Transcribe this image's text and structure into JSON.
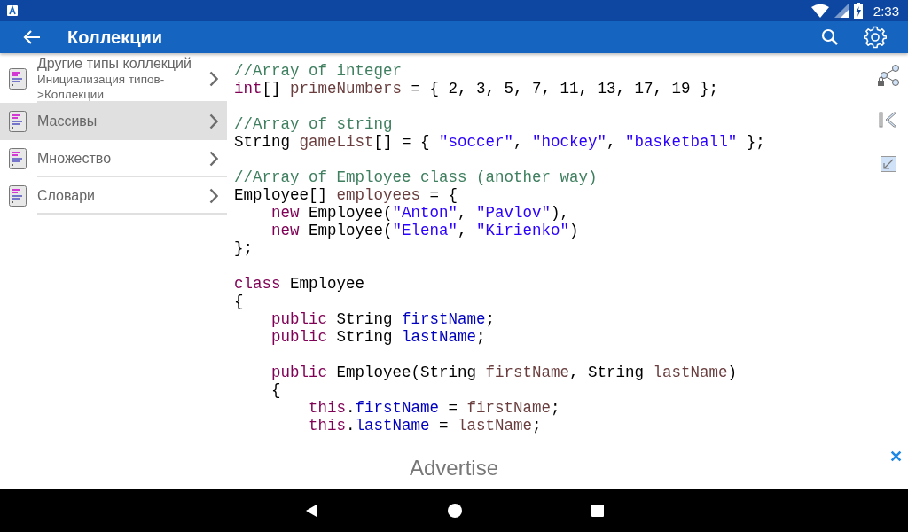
{
  "status_bar": {
    "time": "2:33"
  },
  "app_bar": {
    "title": "Коллекции"
  },
  "sidebar": {
    "items": [
      {
        "title": "Другие типы коллекций",
        "subtitle": "Инициализация типов->Коллекции",
        "selected": false
      },
      {
        "title": "Массивы",
        "selected": true
      },
      {
        "title": "Множество",
        "selected": false
      },
      {
        "title": "Словари",
        "selected": false
      }
    ]
  },
  "code_blocks": [
    {
      "lines": [
        {
          "tokens": [
            {
              "kind": "comment",
              "text": "//Array of integer"
            }
          ]
        },
        {
          "tokens": [
            {
              "kind": "keyword",
              "text": "int"
            },
            {
              "kind": "plain",
              "text": "[] "
            },
            {
              "kind": "variable",
              "text": "primeNumbers"
            },
            {
              "kind": "plain",
              "text": " = { 2, 3, 5, 7, 11, 13, 17, 19 };"
            }
          ]
        }
      ]
    },
    {
      "lines": [
        {
          "tokens": [
            {
              "kind": "comment",
              "text": "//Array of string"
            }
          ]
        },
        {
          "tokens": [
            {
              "kind": "plain",
              "text": "String "
            },
            {
              "kind": "variable",
              "text": "gameList"
            },
            {
              "kind": "plain",
              "text": "[] = { "
            },
            {
              "kind": "string",
              "text": "\"soccer\""
            },
            {
              "kind": "plain",
              "text": ", "
            },
            {
              "kind": "string",
              "text": "\"hockey\""
            },
            {
              "kind": "plain",
              "text": ", "
            },
            {
              "kind": "string",
              "text": "\"basketball\""
            },
            {
              "kind": "plain",
              "text": " };"
            }
          ]
        }
      ]
    },
    {
      "lines": [
        {
          "tokens": [
            {
              "kind": "comment",
              "text": "//Array of Employee class (another way)"
            }
          ]
        },
        {
          "tokens": [
            {
              "kind": "plain",
              "text": "Employee[] "
            },
            {
              "kind": "variable",
              "text": "employees"
            },
            {
              "kind": "plain",
              "text": " = {"
            }
          ]
        },
        {
          "tokens": [
            {
              "kind": "keyword",
              "text": "    new"
            },
            {
              "kind": "plain",
              "text": " Employee("
            },
            {
              "kind": "string",
              "text": "\"Anton\""
            },
            {
              "kind": "plain",
              "text": ", "
            },
            {
              "kind": "string",
              "text": "\"Pavlov\""
            },
            {
              "kind": "plain",
              "text": "),"
            }
          ]
        },
        {
          "tokens": [
            {
              "kind": "keyword",
              "text": "    new"
            },
            {
              "kind": "plain",
              "text": " Employee("
            },
            {
              "kind": "string",
              "text": "\"Elena\""
            },
            {
              "kind": "plain",
              "text": ", "
            },
            {
              "kind": "string",
              "text": "\"Kirienko\""
            },
            {
              "kind": "plain",
              "text": ")"
            }
          ]
        },
        {
          "tokens": [
            {
              "kind": "plain",
              "text": "};"
            }
          ]
        }
      ]
    },
    {
      "lines": [
        {
          "tokens": [
            {
              "kind": "keyword",
              "text": "class"
            },
            {
              "kind": "plain",
              "text": " Employee"
            }
          ]
        },
        {
          "tokens": [
            {
              "kind": "plain",
              "text": "{"
            }
          ]
        },
        {
          "tokens": [
            {
              "kind": "keyword",
              "text": "    public"
            },
            {
              "kind": "plain",
              "text": " String "
            },
            {
              "kind": "field",
              "text": "firstName"
            },
            {
              "kind": "plain",
              "text": ";"
            }
          ]
        },
        {
          "tokens": [
            {
              "kind": "keyword",
              "text": "    public"
            },
            {
              "kind": "plain",
              "text": " String "
            },
            {
              "kind": "field",
              "text": "lastName"
            },
            {
              "kind": "plain",
              "text": ";"
            }
          ]
        }
      ]
    },
    {
      "lines": [
        {
          "tokens": [
            {
              "kind": "keyword",
              "text": "    public"
            },
            {
              "kind": "plain",
              "text": " Employee(String "
            },
            {
              "kind": "variable",
              "text": "firstName"
            },
            {
              "kind": "plain",
              "text": ", String "
            },
            {
              "kind": "variable",
              "text": "lastName"
            },
            {
              "kind": "plain",
              "text": ")"
            }
          ]
        },
        {
          "tokens": [
            {
              "kind": "plain",
              "text": "    {"
            }
          ]
        },
        {
          "tokens": [
            {
              "kind": "keyword",
              "text": "        this"
            },
            {
              "kind": "plain",
              "text": "."
            },
            {
              "kind": "field",
              "text": "firstName"
            },
            {
              "kind": "plain",
              "text": " = "
            },
            {
              "kind": "variable",
              "text": "firstName"
            },
            {
              "kind": "plain",
              "text": ";"
            }
          ]
        },
        {
          "tokens": [
            {
              "kind": "keyword",
              "text": "        this"
            },
            {
              "kind": "plain",
              "text": "."
            },
            {
              "kind": "field",
              "text": "lastName"
            },
            {
              "kind": "plain",
              "text": " = "
            },
            {
              "kind": "variable",
              "text": "lastName"
            },
            {
              "kind": "plain",
              "text": ";"
            }
          ]
        }
      ]
    }
  ],
  "ad_bar": {
    "label": "Advertise",
    "close": "✕"
  }
}
